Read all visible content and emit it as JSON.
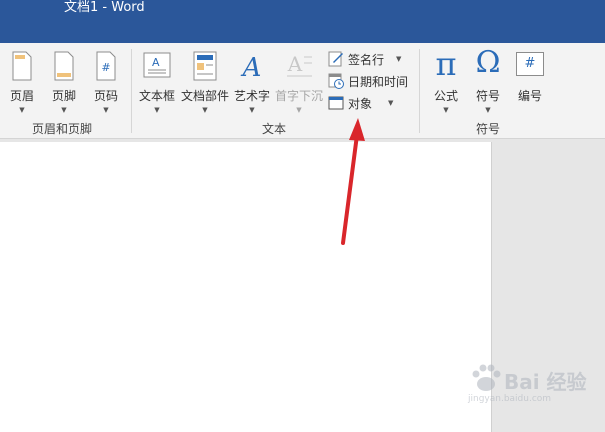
{
  "window": {
    "title": "文档1 - Word"
  },
  "ribbon": {
    "groups": {
      "header_footer": {
        "label": "页眉和页脚",
        "buttons": [
          {
            "label": "页眉",
            "icon": "header-icon"
          },
          {
            "label": "页脚",
            "icon": "footer-icon"
          },
          {
            "label": "页码",
            "icon": "page-number-icon"
          }
        ]
      },
      "text": {
        "label": "文本",
        "buttons": [
          {
            "label": "文本框",
            "icon": "textbox-icon"
          },
          {
            "label": "文档部件",
            "icon": "quick-parts-icon"
          },
          {
            "label": "艺术字",
            "icon": "wordart-icon"
          },
          {
            "label": "首字下沉",
            "icon": "drop-cap-icon",
            "disabled": true
          }
        ],
        "small_buttons": [
          {
            "label": "签名行",
            "icon": "signature-line-icon"
          },
          {
            "label": "日期和时间",
            "icon": "date-time-icon"
          },
          {
            "label": "对象",
            "icon": "object-icon"
          }
        ]
      },
      "symbols": {
        "label": "符号",
        "buttons": [
          {
            "label": "公式",
            "icon": "equation-icon",
            "glyph": "π"
          },
          {
            "label": "符号",
            "icon": "symbol-icon",
            "glyph": "Ω"
          },
          {
            "label": "编号",
            "icon": "numbering-icon",
            "glyph": "#"
          }
        ]
      }
    }
  },
  "colors": {
    "title_bar": "#2b579a",
    "accent_blue": "#2b6cb8",
    "annotation_arrow": "#d9262b"
  },
  "watermark": {
    "text": "Bai 经验",
    "url": "jingyan.baidu.com"
  }
}
